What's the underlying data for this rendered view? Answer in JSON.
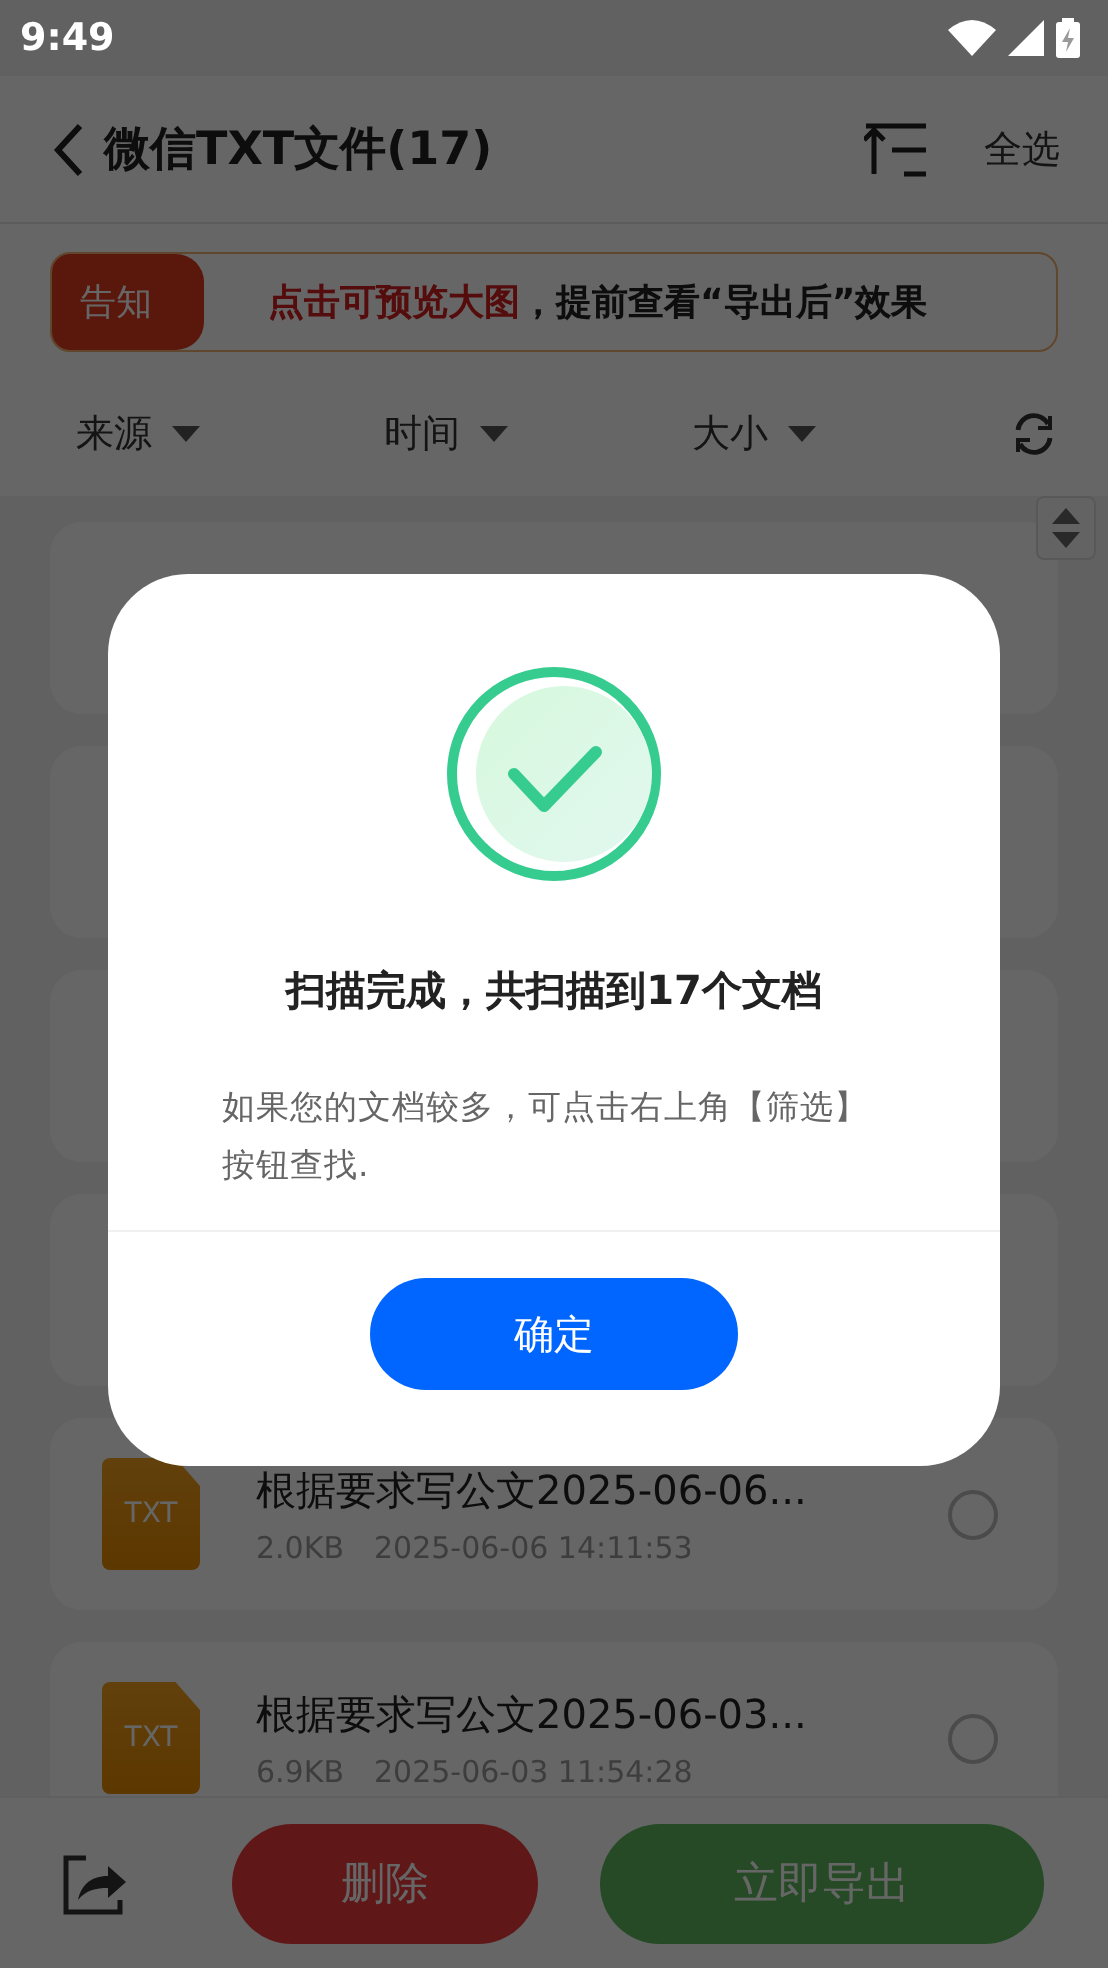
{
  "status_bar": {
    "time": "9:49"
  },
  "header": {
    "title": "微信TXT文件(17)",
    "select_all": "全选"
  },
  "notice": {
    "tag": "告知",
    "highlight": "点击可预览大图",
    "text": "，提前查看“导出后”效果"
  },
  "filters": [
    {
      "label": "来源"
    },
    {
      "label": "时间"
    },
    {
      "label": "大小"
    }
  ],
  "files": [
    {
      "kind": "covered"
    },
    {
      "kind": "covered"
    },
    {
      "kind": "covered"
    },
    {
      "kind": "covered"
    },
    {
      "kind": "file",
      "icon_label": "TXT",
      "name": "根据要求写公文2025-06-06...",
      "size": "2.0KB",
      "date": "2025-06-06 14:11:53",
      "selected": false
    },
    {
      "kind": "file",
      "icon_label": "TXT",
      "name": "根据要求写公文2025-06-03...",
      "size": "6.9KB",
      "date": "2025-06-03 11:54:28",
      "selected": false
    }
  ],
  "bottom_bar": {
    "delete": "删除",
    "export": "立即导出"
  },
  "dialog": {
    "title": "扫描完成，共扫描到17个文档",
    "message": "如果您的文档较多，可点击右上角【筛选】按钮查找.",
    "confirm": "确定"
  }
}
